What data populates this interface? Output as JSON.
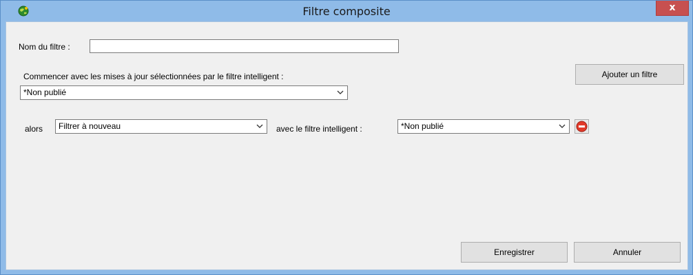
{
  "window": {
    "title": "Filtre composite",
    "close_label": "x"
  },
  "form": {
    "name_label": "Nom du filtre :",
    "name_value": "",
    "start_label": "Commencer avec les mises à jour sélectionnées par le filtre intelligent :",
    "start_value": "*Non publié",
    "add_filter_label": "Ajouter un filtre",
    "row": {
      "then_label": "alors",
      "action_value": "Filtrer à nouveau",
      "with_label": "avec le filtre intelligent :",
      "filter_value": "*Non publié"
    },
    "save_label": "Enregistrer",
    "cancel_label": "Annuler"
  },
  "icons": {
    "app": "globe-icon",
    "dropdown": "chevron-down-icon",
    "remove": "remove-circle-icon"
  }
}
